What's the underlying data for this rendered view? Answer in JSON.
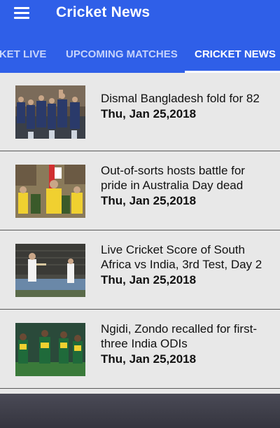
{
  "app": {
    "title": "Cricket News"
  },
  "tabs": [
    {
      "label": "CKET LIVE"
    },
    {
      "label": "UPCOMING MATCHES"
    },
    {
      "label": "CRICKET NEWS"
    }
  ],
  "colors": {
    "appbar": "#2f5fe8",
    "list_background": "#e8e8e8"
  },
  "icons": {
    "menu": "hamburger-menu-icon"
  },
  "news": [
    {
      "headline": "Dismal Bangladesh fold for 82",
      "date": "Thu, Jan 25,2018"
    },
    {
      "headline": "Out-of-sorts hosts battle for pride in Australia Day dead",
      "date": "Thu, Jan 25,2018"
    },
    {
      "headline": "Live Cricket Score of South Africa vs India, 3rd Test, Day 2",
      "date": "Thu, Jan 25,2018"
    },
    {
      "headline": "Ngidi, Zondo recalled for first-three India ODIs",
      "date": "Thu, Jan 25,2018"
    }
  ]
}
